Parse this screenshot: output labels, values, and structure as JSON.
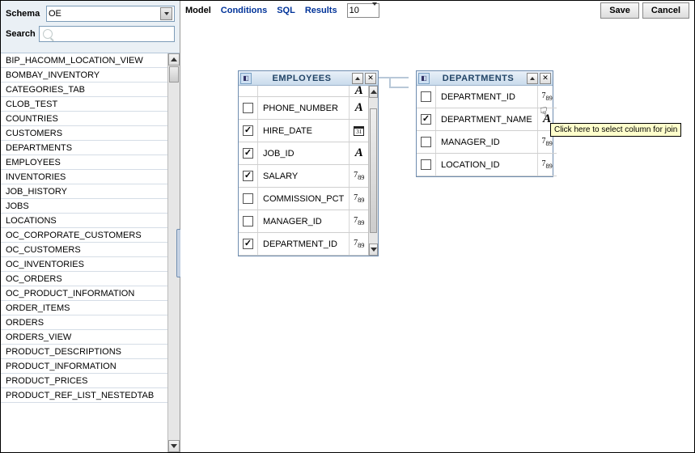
{
  "sidebar": {
    "schema_label": "Schema",
    "schema_value": "OE",
    "search_label": "Search",
    "search_placeholder": "",
    "tables": [
      "BIP_HACOMM_LOCATION_VIEW",
      "BOMBAY_INVENTORY",
      "CATEGORIES_TAB",
      "CLOB_TEST",
      "COUNTRIES",
      "CUSTOMERS",
      "DEPARTMENTS",
      "EMPLOYEES",
      "INVENTORIES",
      "JOB_HISTORY",
      "JOBS",
      "LOCATIONS",
      "OC_CORPORATE_CUSTOMERS",
      "OC_CUSTOMERS",
      "OC_INVENTORIES",
      "OC_ORDERS",
      "OC_PRODUCT_INFORMATION",
      "ORDER_ITEMS",
      "ORDERS",
      "ORDERS_VIEW",
      "PRODUCT_DESCRIPTIONS",
      "PRODUCT_INFORMATION",
      "PRODUCT_PRICES",
      "PRODUCT_REF_LIST_NESTEDTAB"
    ]
  },
  "toolbar": {
    "tabs": {
      "model": "Model",
      "conditions": "Conditions",
      "sql": "SQL",
      "results": "Results"
    },
    "rows_value": "10",
    "save": "Save",
    "cancel": "Cancel"
  },
  "entities": {
    "employees": {
      "title": "EMPLOYEES",
      "columns": [
        {
          "name": "PHONE_NUMBER",
          "checked": false,
          "type": "text"
        },
        {
          "name": "HIRE_DATE",
          "checked": true,
          "type": "date"
        },
        {
          "name": "JOB_ID",
          "checked": true,
          "type": "text"
        },
        {
          "name": "SALARY",
          "checked": true,
          "type": "num"
        },
        {
          "name": "COMMISSION_PCT",
          "checked": false,
          "type": "num"
        },
        {
          "name": "MANAGER_ID",
          "checked": false,
          "type": "num"
        },
        {
          "name": "DEPARTMENT_ID",
          "checked": true,
          "type": "num"
        }
      ]
    },
    "departments": {
      "title": "DEPARTMENTS",
      "columns": [
        {
          "name": "DEPARTMENT_ID",
          "checked": false,
          "type": "num"
        },
        {
          "name": "DEPARTMENT_NAME",
          "checked": true,
          "type": "text"
        },
        {
          "name": "MANAGER_ID",
          "checked": false,
          "type": "num"
        },
        {
          "name": "LOCATION_ID",
          "checked": false,
          "type": "num"
        }
      ]
    }
  },
  "tooltip": "Click here to select column for join"
}
